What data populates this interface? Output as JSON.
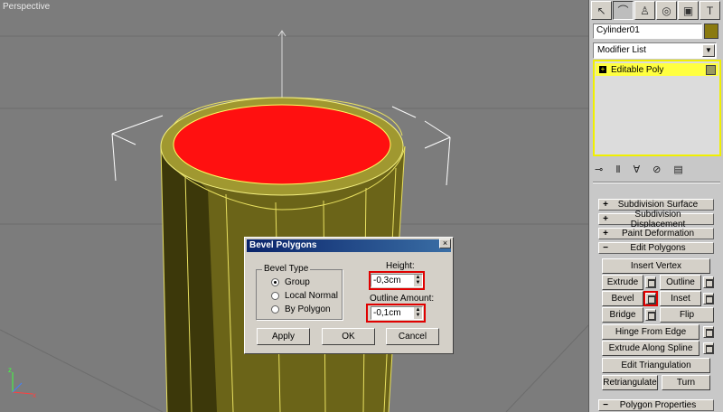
{
  "viewport": {
    "label": "Perspective"
  },
  "panel": {
    "tabs": [
      "create-icon",
      "modify-icon",
      "hierarchy-icon",
      "motion-icon",
      "display-icon",
      "utilities-icon"
    ],
    "object_name": "Cylinder01",
    "object_color": "#8a7a10",
    "modifier_list": "Modifier List",
    "stack_item": "Editable Poly",
    "rollouts": {
      "subdivision_surface": "Subdivision Surface",
      "subdivision_displacement": "Subdivision Displacement",
      "paint_deformation": "Paint Deformation",
      "edit_polygons": "Edit Polygons",
      "polygon_properties": "Polygon Properties"
    },
    "buttons": {
      "insert_vertex": "Insert Vertex",
      "extrude": "Extrude",
      "outline": "Outline",
      "bevel": "Bevel",
      "inset": "Inset",
      "bridge": "Bridge",
      "flip": "Flip",
      "hinge": "Hinge From Edge",
      "extrude_spline": "Extrude Along Spline",
      "edit_triangulation": "Edit Triangulation",
      "retriangulate": "Retriangulate",
      "turn": "Turn"
    }
  },
  "dialog": {
    "title": "Bevel Polygons",
    "close": "×",
    "bevel_type": "Bevel Type",
    "options": [
      "Group",
      "Local Normal",
      "By Polygon"
    ],
    "selected_option": "Group",
    "height_label": "Height:",
    "height_value": "-0,3cm",
    "outline_label": "Outline Amount:",
    "outline_value": "-0,1cm",
    "apply": "Apply",
    "ok": "OK",
    "cancel": "Cancel"
  },
  "colors": {
    "highlight": "#e00000",
    "selection": "#ffff40",
    "cap": "#ff1010"
  }
}
